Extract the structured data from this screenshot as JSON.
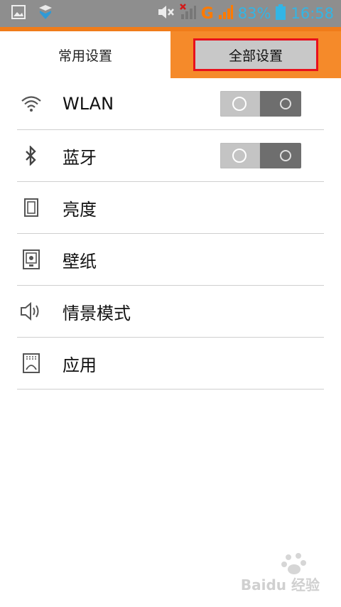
{
  "status_bar": {
    "network": "G",
    "battery": "83%",
    "time": "16:58",
    "icons": [
      "image-icon",
      "shield-notification-icon",
      "mute-icon",
      "signal-no-sim-icon",
      "signal-icon",
      "battery-icon"
    ]
  },
  "tabs": {
    "common": "常用设置",
    "all": "全部设置"
  },
  "settings": {
    "items": [
      {
        "label": "WLAN",
        "icon": "wifi-icon",
        "toggle": true
      },
      {
        "label": "蓝牙",
        "icon": "bluetooth-icon",
        "toggle": true
      },
      {
        "label": "亮度",
        "icon": "brightness-icon",
        "toggle": false
      },
      {
        "label": "壁纸",
        "icon": "wallpaper-icon",
        "toggle": false
      },
      {
        "label": "情景模式",
        "icon": "sound-profile-icon",
        "toggle": false
      },
      {
        "label": "应用",
        "icon": "apps-icon",
        "toggle": false
      }
    ]
  },
  "watermark": "Baidu 经验",
  "colors": {
    "accent_orange": "#f07c1a",
    "highlight_red": "#e8101c",
    "status_blue": "#33b5e5"
  }
}
